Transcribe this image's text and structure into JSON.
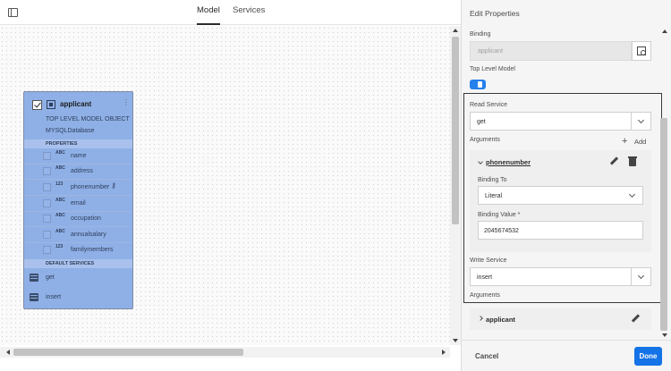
{
  "tabs": {
    "model": "Model",
    "services": "Services"
  },
  "model": {
    "title": "applicant",
    "subtitle": "TOP LEVEL MODEL OBJECT",
    "database": "MYSQLDatabase",
    "menu_glyph": "⋮",
    "properties_header": "PROPERTIES",
    "properties": [
      {
        "type": "ABC",
        "name": "name"
      },
      {
        "type": "ABC",
        "name": "address"
      },
      {
        "type": "123",
        "name": "phonenumber",
        "key": "⚷"
      },
      {
        "type": "ABC",
        "name": "email"
      },
      {
        "type": "ABC",
        "name": "occupation"
      },
      {
        "type": "ABC",
        "name": "annualsalary"
      },
      {
        "type": "123",
        "name": "familymembers"
      }
    ],
    "services_header": "DEFAULT SERVICES",
    "services": [
      {
        "name": "get"
      },
      {
        "name": "insert"
      }
    ]
  },
  "panel": {
    "title": "Edit Properties",
    "binding_label": "Binding",
    "binding_placeholder": "applicant",
    "top_level_label": "Top Level Model",
    "top_level_enabled": true,
    "read_service_label": "Read Service",
    "read_service_value": "get",
    "arguments_label": "Arguments",
    "add_plus": "+",
    "add_label": "Add",
    "argument": {
      "name": "phonenumber",
      "binding_to_label": "Binding To",
      "binding_to_value": "Literal",
      "binding_value_label": "Binding Value *",
      "binding_value": "2045674532"
    },
    "write_service_label": "Write Service",
    "write_service_value": "insert",
    "arguments2_label": "Arguments",
    "argument2_name": "applicant",
    "cancel": "Cancel",
    "done": "Done"
  },
  "colors": {
    "accent": "#1473e6",
    "model_card": "#8fb0e6",
    "toggle": "#2680eb"
  }
}
